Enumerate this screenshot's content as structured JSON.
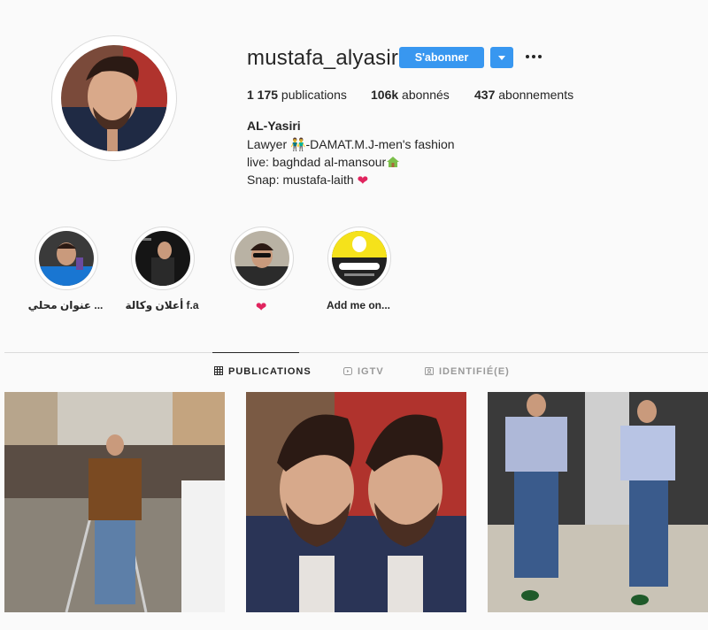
{
  "profile": {
    "username": "mustafa_alyasiri",
    "follow_label": "S'abonner",
    "stats": {
      "posts_count": "1 175",
      "posts_label": " publications",
      "followers_count": "106k",
      "followers_label": " abonnés",
      "following_count": "437",
      "following_label": " abonnements"
    },
    "full_name": "AL-Yasiri",
    "bio": {
      "line1": "Lawyer 👬-DAMAT.M.J-men's fashion",
      "line2": "live: baghdad al-mansour",
      "line3": "Snap: mustafa-laith "
    }
  },
  "highlights": [
    {
      "label": "عنوان محلي ..."
    },
    {
      "label": "أعلان وكالة f.a"
    },
    {
      "label": "❤"
    },
    {
      "label": "Add me on..."
    }
  ],
  "tabs": [
    {
      "label": "PUBLICATIONS",
      "icon": "grid-icon",
      "active": true
    },
    {
      "label": "IGTV",
      "icon": "igtv-icon",
      "active": false
    },
    {
      "label": "IDENTIFIÉ(E)",
      "icon": "tagged-icon",
      "active": false
    }
  ],
  "colors": {
    "accent": "#3897f0",
    "background": "#fafafa",
    "text": "#262626",
    "border": "#dbdbdb",
    "heart": "#e0245e"
  }
}
